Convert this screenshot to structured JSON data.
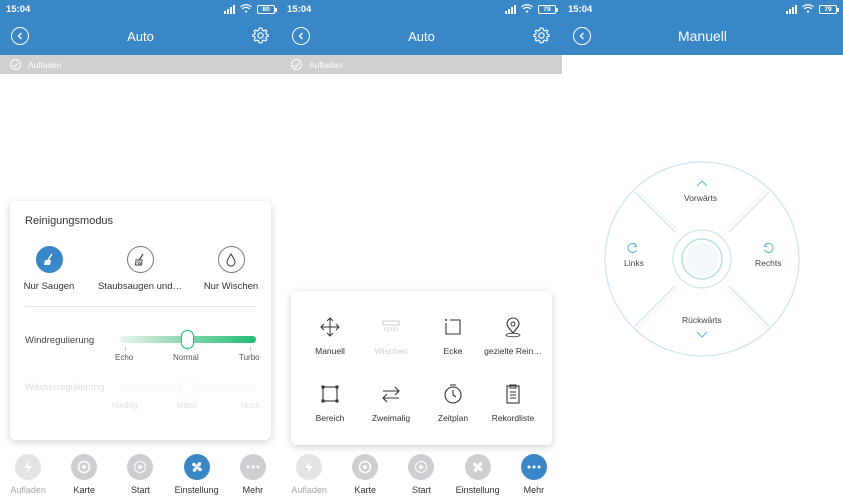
{
  "status": {
    "time": "15:04",
    "battery_left": "80",
    "battery_mid": "79",
    "battery_right": "79"
  },
  "screen_auto": {
    "title": "Auto",
    "banner": "Aufladen"
  },
  "cleaning_mode": {
    "title": "Reinigungsmodus",
    "modes": [
      "Nur Saugen",
      "Staubsaugen und…",
      "Nur Wischen"
    ],
    "wind": {
      "label": "Windregulierung",
      "ticks": [
        "Echo",
        "Normal",
        "Turbo"
      ],
      "value": "Normal"
    },
    "water": {
      "label": "Wasserregulierung",
      "ticks": [
        "Niedrig",
        "Mittel",
        "Hoch"
      ],
      "value": "Mittel"
    }
  },
  "more_menu": {
    "items": [
      "Manuell",
      "Wischen",
      "Ecke",
      "gezielte Rein…",
      "Bereich",
      "Zweimalig",
      "Zeitplan",
      "Rekordliste"
    ]
  },
  "bottom_nav": {
    "items": [
      "Aufladen",
      "Karte",
      "Start",
      "Einstellung",
      "Mehr"
    ]
  },
  "manual": {
    "title": "Manuell",
    "forward": "Vorwärts",
    "left": "Links",
    "right": "Rechts",
    "backward": "Rückwärts"
  },
  "colors": {
    "brand": "#3a87c8",
    "accent_green": "#1fbf78",
    "banner_gray": "#d0d0d0"
  }
}
